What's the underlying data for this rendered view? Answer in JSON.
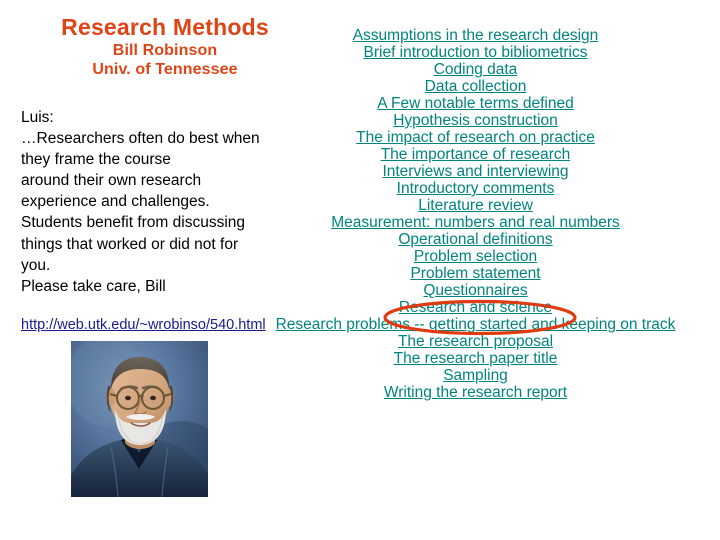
{
  "slide": {
    "background_color": "#ffffff",
    "title": {
      "main": "Research Methods",
      "author": "Bill Robinson",
      "affiliation": "Univ. of Tennessee",
      "color": "#DE4516"
    },
    "body_text": {
      "color": "#000000",
      "lines": [
        "Luis:",
        "…Researchers often do best when",
        "they frame the course",
        "around their own research",
        "experience and challenges.",
        "Students benefit from discussing",
        "things that worked or did not for",
        "you.",
        "Please take care,  Bill"
      ]
    },
    "url_link": {
      "text": "http://web.utk.edu/~wrobinso/540.html",
      "color": "#1B1B8F"
    },
    "portrait": {
      "alt": "Portrait photograph of Bill Robinson, an older bearded man with glasses wearing a denim shirt against a mottled blue studio backdrop"
    },
    "link_list": {
      "color": "#018480",
      "items": [
        "Assumptions in the research design",
        "Brief introduction to bibliometrics",
        "Coding data",
        "Data collection",
        "A Few notable terms defined",
        "Hypothesis construction",
        "The impact of research on practice",
        "The importance of research",
        "Interviews and interviewing",
        "Introductory comments",
        "Literature review",
        "Measurement: numbers and real numbers",
        "Operational definitions",
        "Problem selection",
        "Problem statement",
        "Questionnaires",
        "Research and science",
        "Research problems -- getting started and keeping on track",
        "The research proposal",
        "The research paper title",
        "Sampling",
        "Writing the research report"
      ]
    },
    "annotation": {
      "type": "ellipse-highlight",
      "target": "Problem selection",
      "color": "#E03A10"
    }
  }
}
